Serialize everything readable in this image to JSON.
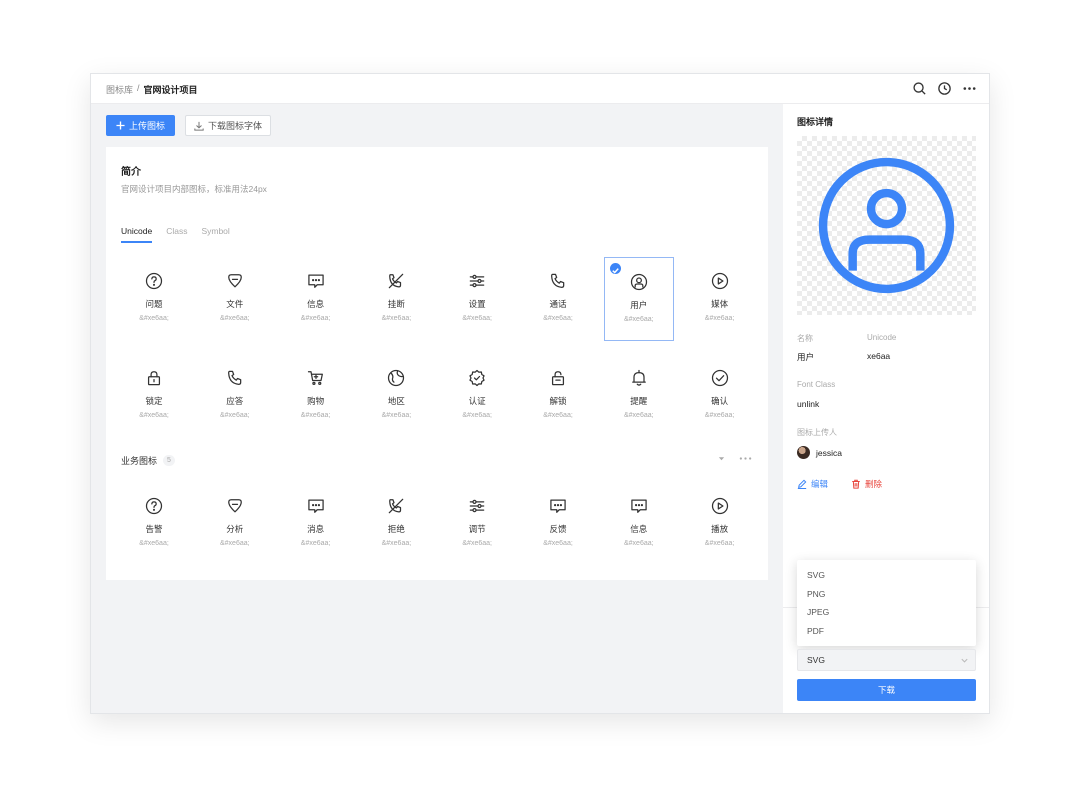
{
  "colors": {
    "accent": "#3c85f7",
    "danger": "#e8453c",
    "panel_bg": "#f2f3f5"
  },
  "breadcrumb": {
    "root": "图标库",
    "separator": "/",
    "current": "官网设计项目"
  },
  "top_actions": {
    "icons": [
      "search-icon",
      "history-icon",
      "more-icon"
    ]
  },
  "toolbar": {
    "upload_label": "上传图标",
    "download_font_label": "下载图标字体"
  },
  "intro": {
    "title": "简介",
    "description": "官网设计项目内部图标，标准用法24px"
  },
  "tabs": [
    {
      "label": "Unicode",
      "active": true
    },
    {
      "label": "Class",
      "active": false
    },
    {
      "label": "Symbol",
      "active": false
    }
  ],
  "icon_rows": [
    [
      {
        "icon": "question-icon",
        "name": "问题",
        "code": "&#xe6aa;"
      },
      {
        "icon": "heart-bubble-icon",
        "name": "文件",
        "code": "&#xe6aa;"
      },
      {
        "icon": "message-icon",
        "name": "信息",
        "code": "&#xe6aa;"
      },
      {
        "icon": "phone-off-icon",
        "name": "挂断",
        "code": "&#xe6aa;"
      },
      {
        "icon": "sliders-icon",
        "name": "设置",
        "code": "&#xe6aa;"
      },
      {
        "icon": "phone-icon",
        "name": "通话",
        "code": "&#xe6aa;"
      },
      {
        "icon": "user-circle-icon",
        "name": "用户",
        "code": "&#xe6aa;",
        "selected": true
      },
      {
        "icon": "play-circle-icon",
        "name": "媒体",
        "code": "&#xe6aa;"
      }
    ],
    [
      {
        "icon": "lock-icon",
        "name": "锁定",
        "code": "&#xe6aa;"
      },
      {
        "icon": "phone-icon",
        "name": "应答",
        "code": "&#xe6aa;"
      },
      {
        "icon": "cart-icon",
        "name": "购物",
        "code": "&#xe6aa;"
      },
      {
        "icon": "globe-icon",
        "name": "地区",
        "code": "&#xe6aa;"
      },
      {
        "icon": "badge-check-icon",
        "name": "认证",
        "code": "&#xe6aa;"
      },
      {
        "icon": "unlock-icon",
        "name": "解锁",
        "code": "&#xe6aa;"
      },
      {
        "icon": "bell-icon",
        "name": "提醒",
        "code": "&#xe6aa;"
      },
      {
        "icon": "check-circle-icon",
        "name": "确认",
        "code": "&#xe6aa;"
      }
    ]
  ],
  "business_group": {
    "title": "业务图标",
    "count": "5",
    "icons": [
      {
        "icon": "question-icon",
        "name": "告警",
        "code": "&#xe6aa;"
      },
      {
        "icon": "heart-bubble-icon",
        "name": "分析",
        "code": "&#xe6aa;"
      },
      {
        "icon": "message-icon",
        "name": "消息",
        "code": "&#xe6aa;"
      },
      {
        "icon": "phone-off-icon",
        "name": "拒绝",
        "code": "&#xe6aa;"
      },
      {
        "icon": "sliders-icon",
        "name": "调节",
        "code": "&#xe6aa;"
      },
      {
        "icon": "message-icon",
        "name": "反馈",
        "code": "&#xe6aa;"
      },
      {
        "icon": "message-icon",
        "name": "信息",
        "code": "&#xe6aa;"
      },
      {
        "icon": "play-circle-icon",
        "name": "播放",
        "code": "&#xe6aa;"
      }
    ]
  },
  "detail": {
    "title": "图标详情",
    "name_label": "名称",
    "name_value": "用户",
    "unicode_label": "Unicode",
    "unicode_value": "xe6aa",
    "font_class_label": "Font Class",
    "font_class_value": "unlink",
    "uploader_label": "图标上传人",
    "uploader_name": "jessica",
    "edit_label": "编辑",
    "delete_label": "删除"
  },
  "download": {
    "format_options": [
      "SVG",
      "PNG",
      "JPEG",
      "PDF"
    ],
    "selected_format": "SVG",
    "button_label": "下载"
  }
}
